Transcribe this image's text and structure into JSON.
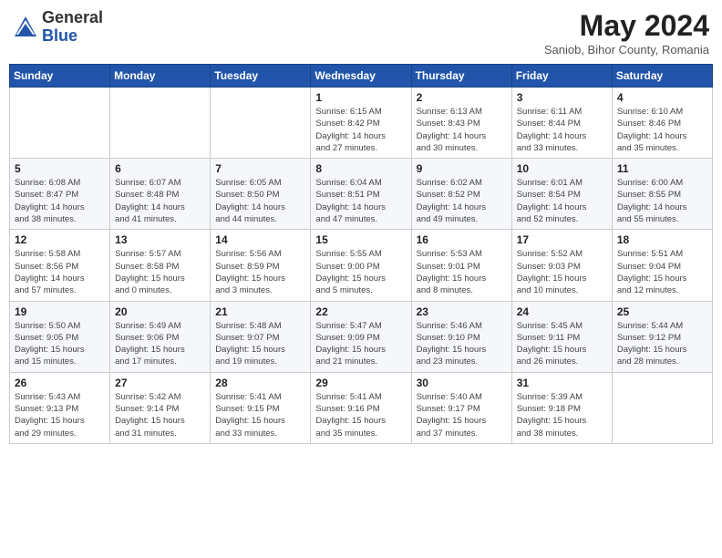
{
  "header": {
    "logo_general": "General",
    "logo_blue": "Blue",
    "month_title": "May 2024",
    "subtitle": "Saniob, Bihor County, Romania"
  },
  "weekdays": [
    "Sunday",
    "Monday",
    "Tuesday",
    "Wednesday",
    "Thursday",
    "Friday",
    "Saturday"
  ],
  "weeks": [
    [
      {
        "day": "",
        "info": ""
      },
      {
        "day": "",
        "info": ""
      },
      {
        "day": "",
        "info": ""
      },
      {
        "day": "1",
        "info": "Sunrise: 6:15 AM\nSunset: 8:42 PM\nDaylight: 14 hours\nand 27 minutes."
      },
      {
        "day": "2",
        "info": "Sunrise: 6:13 AM\nSunset: 8:43 PM\nDaylight: 14 hours\nand 30 minutes."
      },
      {
        "day": "3",
        "info": "Sunrise: 6:11 AM\nSunset: 8:44 PM\nDaylight: 14 hours\nand 33 minutes."
      },
      {
        "day": "4",
        "info": "Sunrise: 6:10 AM\nSunset: 8:46 PM\nDaylight: 14 hours\nand 35 minutes."
      }
    ],
    [
      {
        "day": "5",
        "info": "Sunrise: 6:08 AM\nSunset: 8:47 PM\nDaylight: 14 hours\nand 38 minutes."
      },
      {
        "day": "6",
        "info": "Sunrise: 6:07 AM\nSunset: 8:48 PM\nDaylight: 14 hours\nand 41 minutes."
      },
      {
        "day": "7",
        "info": "Sunrise: 6:05 AM\nSunset: 8:50 PM\nDaylight: 14 hours\nand 44 minutes."
      },
      {
        "day": "8",
        "info": "Sunrise: 6:04 AM\nSunset: 8:51 PM\nDaylight: 14 hours\nand 47 minutes."
      },
      {
        "day": "9",
        "info": "Sunrise: 6:02 AM\nSunset: 8:52 PM\nDaylight: 14 hours\nand 49 minutes."
      },
      {
        "day": "10",
        "info": "Sunrise: 6:01 AM\nSunset: 8:54 PM\nDaylight: 14 hours\nand 52 minutes."
      },
      {
        "day": "11",
        "info": "Sunrise: 6:00 AM\nSunset: 8:55 PM\nDaylight: 14 hours\nand 55 minutes."
      }
    ],
    [
      {
        "day": "12",
        "info": "Sunrise: 5:58 AM\nSunset: 8:56 PM\nDaylight: 14 hours\nand 57 minutes."
      },
      {
        "day": "13",
        "info": "Sunrise: 5:57 AM\nSunset: 8:58 PM\nDaylight: 15 hours\nand 0 minutes."
      },
      {
        "day": "14",
        "info": "Sunrise: 5:56 AM\nSunset: 8:59 PM\nDaylight: 15 hours\nand 3 minutes."
      },
      {
        "day": "15",
        "info": "Sunrise: 5:55 AM\nSunset: 9:00 PM\nDaylight: 15 hours\nand 5 minutes."
      },
      {
        "day": "16",
        "info": "Sunrise: 5:53 AM\nSunset: 9:01 PM\nDaylight: 15 hours\nand 8 minutes."
      },
      {
        "day": "17",
        "info": "Sunrise: 5:52 AM\nSunset: 9:03 PM\nDaylight: 15 hours\nand 10 minutes."
      },
      {
        "day": "18",
        "info": "Sunrise: 5:51 AM\nSunset: 9:04 PM\nDaylight: 15 hours\nand 12 minutes."
      }
    ],
    [
      {
        "day": "19",
        "info": "Sunrise: 5:50 AM\nSunset: 9:05 PM\nDaylight: 15 hours\nand 15 minutes."
      },
      {
        "day": "20",
        "info": "Sunrise: 5:49 AM\nSunset: 9:06 PM\nDaylight: 15 hours\nand 17 minutes."
      },
      {
        "day": "21",
        "info": "Sunrise: 5:48 AM\nSunset: 9:07 PM\nDaylight: 15 hours\nand 19 minutes."
      },
      {
        "day": "22",
        "info": "Sunrise: 5:47 AM\nSunset: 9:09 PM\nDaylight: 15 hours\nand 21 minutes."
      },
      {
        "day": "23",
        "info": "Sunrise: 5:46 AM\nSunset: 9:10 PM\nDaylight: 15 hours\nand 23 minutes."
      },
      {
        "day": "24",
        "info": "Sunrise: 5:45 AM\nSunset: 9:11 PM\nDaylight: 15 hours\nand 26 minutes."
      },
      {
        "day": "25",
        "info": "Sunrise: 5:44 AM\nSunset: 9:12 PM\nDaylight: 15 hours\nand 28 minutes."
      }
    ],
    [
      {
        "day": "26",
        "info": "Sunrise: 5:43 AM\nSunset: 9:13 PM\nDaylight: 15 hours\nand 29 minutes."
      },
      {
        "day": "27",
        "info": "Sunrise: 5:42 AM\nSunset: 9:14 PM\nDaylight: 15 hours\nand 31 minutes."
      },
      {
        "day": "28",
        "info": "Sunrise: 5:41 AM\nSunset: 9:15 PM\nDaylight: 15 hours\nand 33 minutes."
      },
      {
        "day": "29",
        "info": "Sunrise: 5:41 AM\nSunset: 9:16 PM\nDaylight: 15 hours\nand 35 minutes."
      },
      {
        "day": "30",
        "info": "Sunrise: 5:40 AM\nSunset: 9:17 PM\nDaylight: 15 hours\nand 37 minutes."
      },
      {
        "day": "31",
        "info": "Sunrise: 5:39 AM\nSunset: 9:18 PM\nDaylight: 15 hours\nand 38 minutes."
      },
      {
        "day": "",
        "info": ""
      }
    ]
  ]
}
